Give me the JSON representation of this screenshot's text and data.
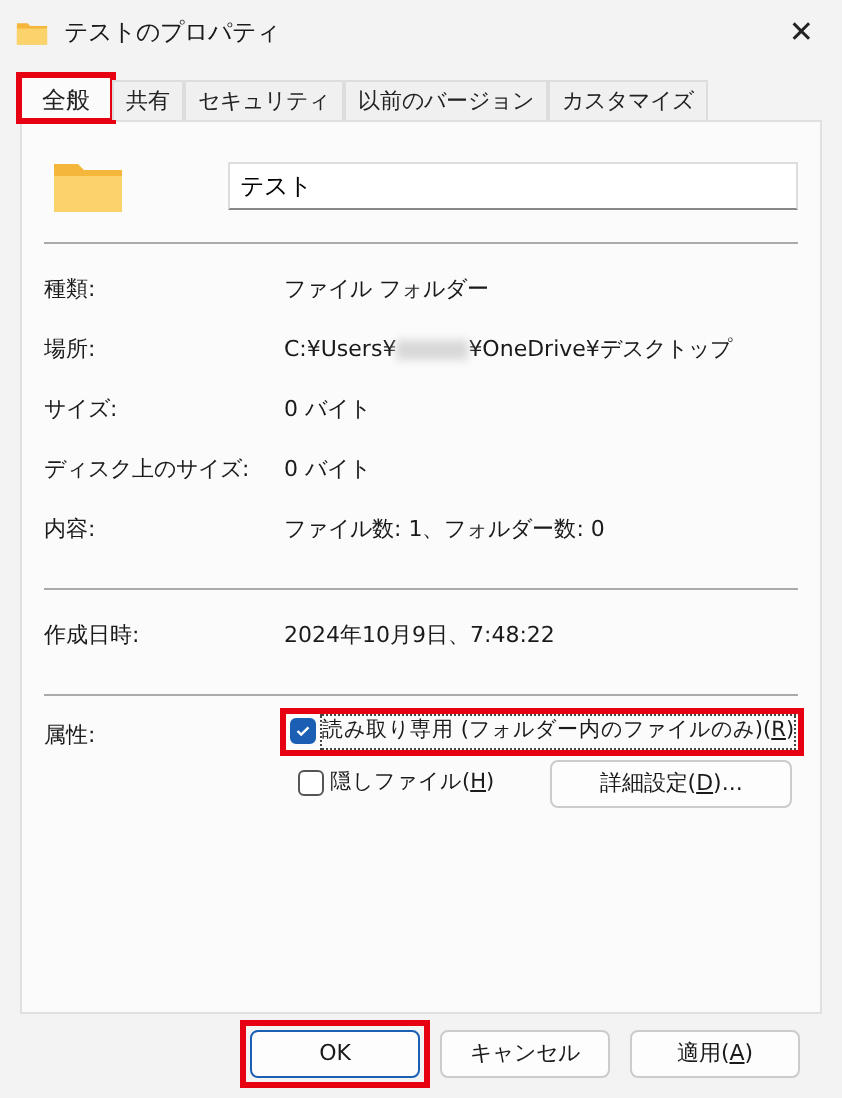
{
  "window": {
    "title": "テストのプロパティ",
    "close": "✕"
  },
  "tabs": [
    {
      "label": "全般",
      "selected": true,
      "highlighted": true
    },
    {
      "label": "共有",
      "selected": false,
      "highlighted": false
    },
    {
      "label": "セキュリティ",
      "selected": false,
      "highlighted": false
    },
    {
      "label": "以前のバージョン",
      "selected": false,
      "highlighted": false
    },
    {
      "label": "カスタマイズ",
      "selected": false,
      "highlighted": false
    }
  ],
  "name_field": {
    "value": "テスト"
  },
  "sections": [
    [
      {
        "label": "種類:",
        "value": "ファイル フォルダー"
      },
      {
        "label": "場所:",
        "value": "C:¥Users¥",
        "redacted": true,
        "value_after": "¥OneDrive¥デスクトップ"
      },
      {
        "label": "サイズ:",
        "value": "0 バイト"
      },
      {
        "label": "ディスク上のサイズ:",
        "value": "0 バイト"
      },
      {
        "label": "内容:",
        "value": "ファイル数: 1、フォルダー数: 0"
      }
    ],
    [
      {
        "label": "作成日時:",
        "value": "2024年10月9日、7:48:22"
      }
    ]
  ],
  "attributes": {
    "label": "属性:",
    "checkboxes": [
      {
        "label_before": "読み取り専用 (フォルダー内のファイルのみ)(",
        "access_key": "R",
        "label_after": ")",
        "checked": true,
        "highlighted": true,
        "focused": true
      },
      {
        "label_before": "隠しファイル(",
        "access_key": "H",
        "label_after": ")",
        "checked": false,
        "highlighted": false,
        "focused": false
      }
    ],
    "advanced_button": {
      "label_before": "詳細設定(",
      "access_key": "D",
      "label_after": ")..."
    }
  },
  "buttons": [
    {
      "label_before": "OK",
      "default": true,
      "highlighted": true
    },
    {
      "label_before": "キャンセル",
      "default": false,
      "highlighted": false
    },
    {
      "label_before": "適用(",
      "access_key": "A",
      "label_after": ")",
      "default": false,
      "highlighted": false
    }
  ]
}
